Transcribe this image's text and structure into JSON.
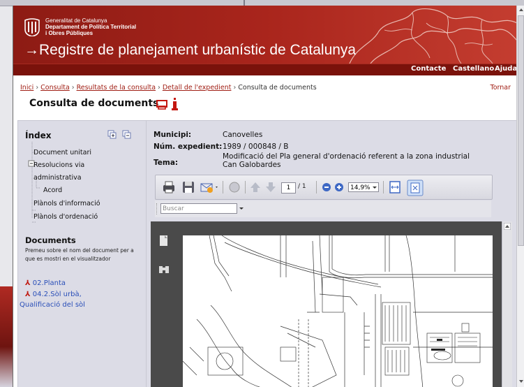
{
  "header": {
    "org_line1": "Generalitat de Catalunya",
    "org_line2": "Departament de Política Territorial",
    "org_line3": "i Obres Públiques",
    "site_title": "→Registre de planejament urbanístic de Catalunya"
  },
  "topnav": {
    "contacte": "Contacte",
    "castellano": "Castellano",
    "ajuda": "Ajuda"
  },
  "breadcrumb": {
    "inici": "Inici",
    "consulta": "Consulta",
    "resultats": "Resultats de la consulta",
    "detall": "Detall de l'expedient",
    "current": "Consulta de documents",
    "sep": "›",
    "tornar": "Tornar"
  },
  "page_title": "Consulta de documents",
  "sidebar": {
    "index_title": "Índex",
    "tree": {
      "document_unitari": "Document unitari",
      "resolucions_1": "Resolucions via",
      "resolucions_2": "administrativa",
      "acord": "Acord",
      "plans_info": "Plànols d'informació",
      "plans_ord": "Plànols d'ordenació"
    },
    "documents_title": "Documents",
    "documents_help": "Premeu sobre el nom del document per a que es mostri en el visualitzador",
    "doc1": "02.Planta",
    "doc2_line1": "04.2.Sòl urbà,",
    "doc2_line2": "Qualificació del sòl"
  },
  "meta": {
    "municipi_label": "Municipi:",
    "municipi_value": "Canovelles",
    "expedient_label": "Núm. expedient:",
    "expedient_value": "1989 / 000848 / B",
    "tema_label": "Tema:",
    "tema_line1": "Modificació del Pla general d'ordenació referent a la zona industrial",
    "tema_line2": "Can Galobardes"
  },
  "viewer": {
    "page_current": "1",
    "page_total": "/ 1",
    "zoom": "14,9%",
    "search_placeholder": "Buscar"
  },
  "colors": {
    "brand_red": "#a9251c",
    "link_red": "#a01e14",
    "link_blue": "#2a4fb8"
  }
}
